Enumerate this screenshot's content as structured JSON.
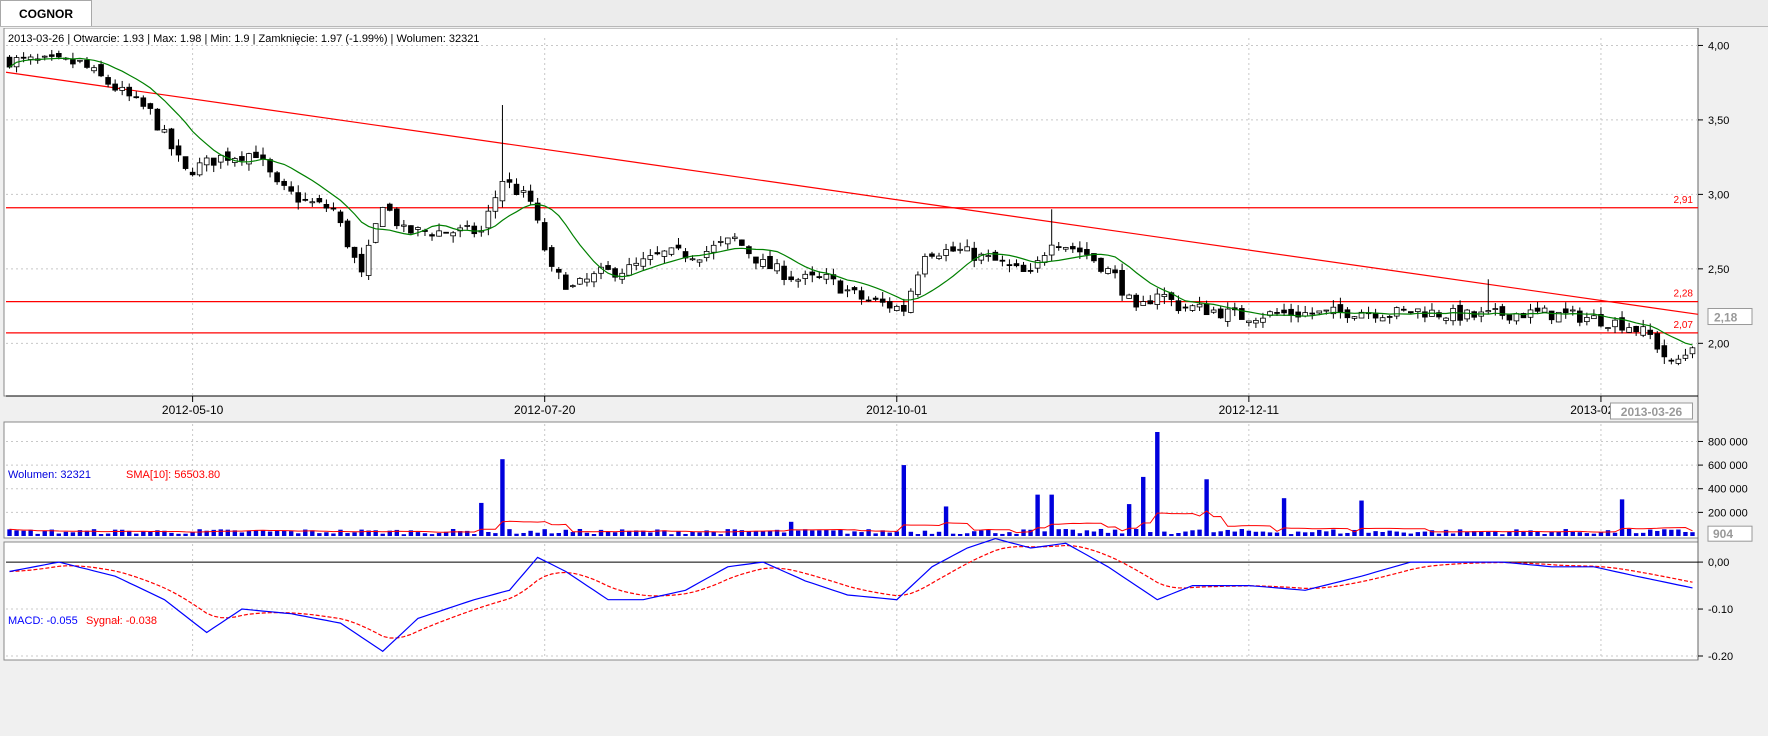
{
  "tab": {
    "label": "COGNOR"
  },
  "header": {
    "info": "2013-03-26 | Otwarcie: 1.93 | Max: 1.98 | Min: 1.9 | Zamknięcie: 1.97 (-1.99%) | Wolumen: 32321",
    "volume_label": "Wolumen: 32321",
    "volume_sma_label": "SMA[10]: 56503.80",
    "macd_label": "MACD: -0.055",
    "signal_label": "Sygnał: -0.038"
  },
  "price_axis": {
    "ticks": [
      "4,00",
      "3,50",
      "3,00",
      "2,50",
      "2,00"
    ],
    "current": "2,18"
  },
  "volume_axis": {
    "ticks": [
      "800 000",
      "600 000",
      "400 000",
      "200 000"
    ],
    "current": "904"
  },
  "macd_axis": {
    "ticks": [
      "0,00",
      "-0.10",
      "-0.20"
    ]
  },
  "date_axis": {
    "ticks": [
      "2012-05-10",
      "2012-07-20",
      "2012-10-01",
      "2012-12-11",
      "2013-02-26"
    ],
    "current": "2013-03-26"
  },
  "level_labels": [
    "2,91",
    "2,28",
    "2,07"
  ],
  "colors": {
    "level_line": "#ff0000",
    "sma_line": "#008000",
    "volume_bar": "#0000dd",
    "macd_line": "#0000ff",
    "signal_line": "#ff0000"
  },
  "chart_data": [
    {
      "type": "candlestick",
      "ylim": [
        1.7,
        4.05
      ],
      "levels": [
        2.91,
        2.28,
        2.07
      ],
      "trendline": {
        "from": [
          0,
          3.82
        ],
        "to": [
          239,
          2.2
        ]
      },
      "close_anchors": [
        [
          0,
          3.9
        ],
        [
          10,
          3.88
        ],
        [
          20,
          3.55
        ],
        [
          25,
          3.15
        ],
        [
          30,
          3.25
        ],
        [
          35,
          3.28
        ],
        [
          38,
          3.05
        ],
        [
          42,
          2.95
        ],
        [
          46,
          2.9
        ],
        [
          50,
          2.45
        ],
        [
          53,
          2.95
        ],
        [
          56,
          2.75
        ],
        [
          60,
          2.75
        ],
        [
          64,
          2.75
        ],
        [
          67,
          2.75
        ],
        [
          70,
          3.1
        ],
        [
          74,
          2.95
        ],
        [
          77,
          2.48
        ],
        [
          80,
          2.37
        ],
        [
          84,
          2.47
        ],
        [
          88,
          2.5
        ],
        [
          93,
          2.6
        ],
        [
          98,
          2.6
        ],
        [
          103,
          2.7
        ],
        [
          107,
          2.53
        ],
        [
          112,
          2.43
        ],
        [
          116,
          2.43
        ],
        [
          121,
          2.3
        ],
        [
          127,
          2.23
        ],
        [
          130,
          2.62
        ],
        [
          135,
          2.62
        ],
        [
          140,
          2.55
        ],
        [
          145,
          2.45
        ],
        [
          148,
          2.7
        ],
        [
          153,
          2.6
        ],
        [
          157,
          2.45
        ],
        [
          160,
          2.2
        ],
        [
          163,
          2.35
        ],
        [
          166,
          2.25
        ],
        [
          171,
          2.22
        ],
        [
          175,
          2.18
        ],
        [
          180,
          2.2
        ],
        [
          183,
          2.2
        ],
        [
          187,
          2.2
        ],
        [
          192,
          2.22
        ],
        [
          196,
          2.2
        ],
        [
          200,
          2.22
        ],
        [
          203,
          2.2
        ],
        [
          208,
          2.18
        ],
        [
          213,
          2.2
        ],
        [
          218,
          2.2
        ],
        [
          223,
          2.18
        ],
        [
          227,
          2.15
        ],
        [
          230,
          2.12
        ],
        [
          233,
          2.05
        ],
        [
          236,
          1.85
        ],
        [
          239,
          1.97
        ]
      ],
      "last_candle": {
        "date": "2013-03-26",
        "open": 1.93,
        "high": 1.98,
        "low": 1.9,
        "close": 1.97
      },
      "sma_visible": true
    },
    {
      "type": "bar",
      "series": [
        {
          "name": "Wolumen"
        },
        {
          "name": "SMA[10]"
        }
      ],
      "ylim": [
        0,
        880000
      ],
      "spikes": [
        [
          70,
          650000
        ],
        [
          67,
          280000
        ],
        [
          111,
          120000
        ],
        [
          127,
          600000
        ],
        [
          133,
          250000
        ],
        [
          146,
          350000
        ],
        [
          148,
          350000
        ],
        [
          159,
          270000
        ],
        [
          161,
          500000
        ],
        [
          163,
          880000
        ],
        [
          170,
          480000
        ],
        [
          181,
          320000
        ],
        [
          192,
          300000
        ],
        [
          229,
          310000
        ]
      ]
    },
    {
      "type": "line",
      "series": [
        {
          "name": "MACD"
        },
        {
          "name": "Sygnał"
        }
      ],
      "ylim": [
        -0.2,
        0.03
      ],
      "macd_anchors": [
        [
          0,
          -0.02
        ],
        [
          7,
          0.0
        ],
        [
          15,
          -0.03
        ],
        [
          22,
          -0.08
        ],
        [
          28,
          -0.15
        ],
        [
          33,
          -0.1
        ],
        [
          40,
          -0.11
        ],
        [
          47,
          -0.13
        ],
        [
          53,
          -0.19
        ],
        [
          58,
          -0.12
        ],
        [
          66,
          -0.08
        ],
        [
          71,
          -0.06
        ],
        [
          75,
          0.01
        ],
        [
          79,
          -0.02
        ],
        [
          85,
          -0.08
        ],
        [
          90,
          -0.08
        ],
        [
          96,
          -0.06
        ],
        [
          102,
          -0.01
        ],
        [
          107,
          0.0
        ],
        [
          113,
          -0.04
        ],
        [
          119,
          -0.07
        ],
        [
          126,
          -0.08
        ],
        [
          131,
          -0.01
        ],
        [
          136,
          0.03
        ],
        [
          140,
          0.05
        ],
        [
          145,
          0.03
        ],
        [
          150,
          0.04
        ],
        [
          156,
          -0.01
        ],
        [
          163,
          -0.08
        ],
        [
          168,
          -0.05
        ],
        [
          176,
          -0.05
        ],
        [
          184,
          -0.06
        ],
        [
          192,
          -0.03
        ],
        [
          199,
          0.0
        ],
        [
          205,
          0.0
        ],
        [
          212,
          0.0
        ],
        [
          219,
          -0.01
        ],
        [
          225,
          -0.01
        ],
        [
          231,
          -0.03
        ],
        [
          239,
          -0.055
        ]
      ]
    }
  ]
}
